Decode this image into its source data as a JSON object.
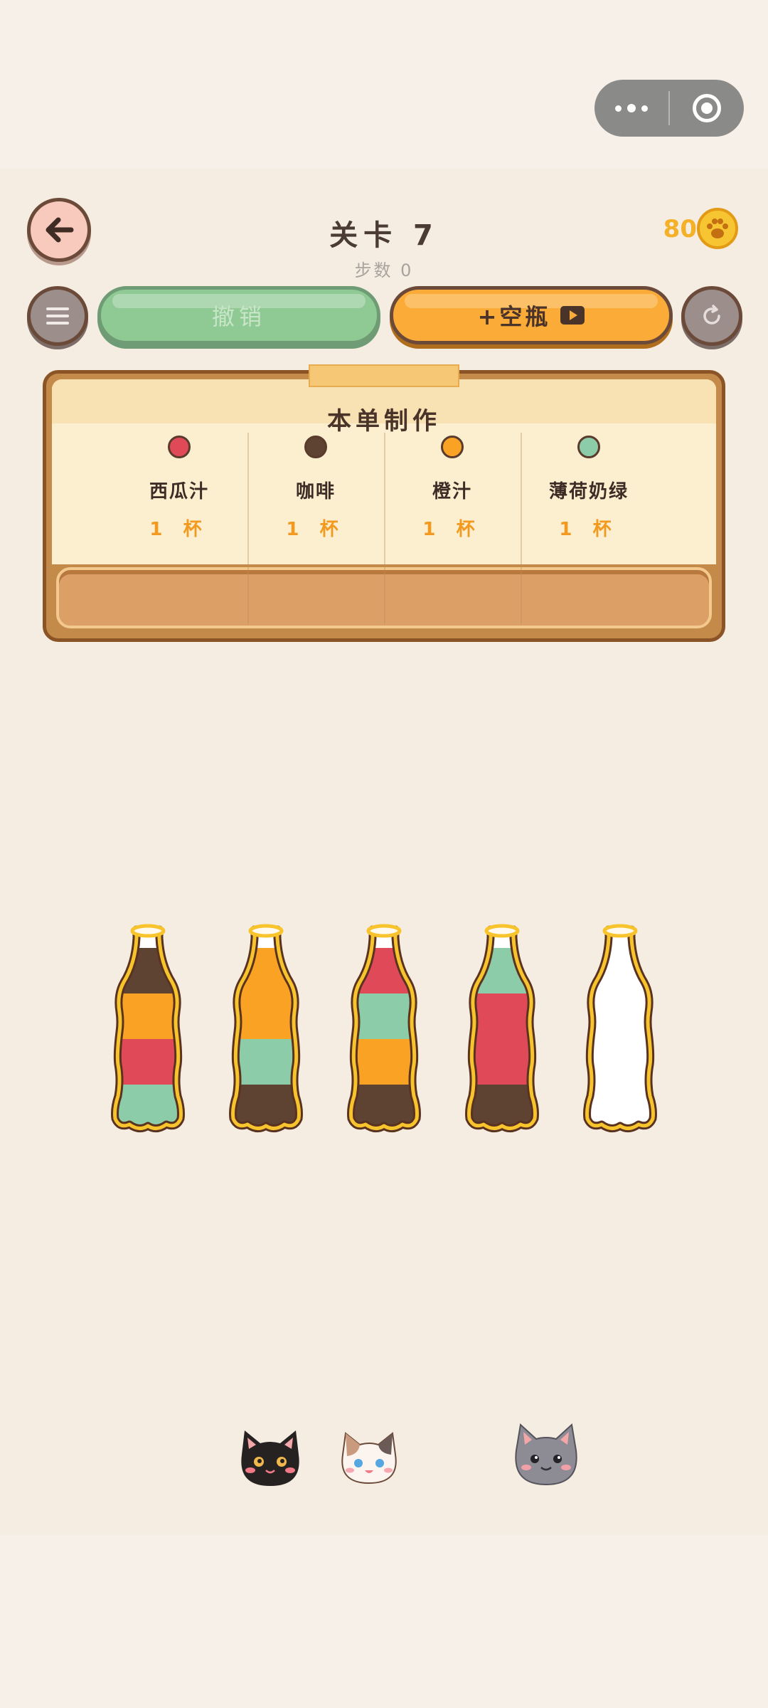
{
  "status": {
    "more_icon": "more-dots-icon",
    "close_icon": "target-circle-icon"
  },
  "header": {
    "level_title": "关卡 7",
    "steps_label": "步数 0",
    "coins": "80",
    "coin_icon": "paw-coin-icon"
  },
  "toolbar": {
    "menu_icon": "menu-icon",
    "undo_label": "撤销",
    "add_bottle_label": "+空瓶",
    "add_bottle_icon": "video-icon",
    "restart_icon": "restart-icon"
  },
  "order": {
    "title": "本单制作",
    "items": [
      {
        "name": "西瓜汁",
        "qty": "1 杯",
        "color": "#e04a58"
      },
      {
        "name": "咖啡",
        "qty": "1 杯",
        "color": "#5e4232"
      },
      {
        "name": "橙汁",
        "qty": "1 杯",
        "color": "#f9a224"
      },
      {
        "name": "薄荷奶绿",
        "qty": "1 杯",
        "color": "#8ccca8"
      }
    ]
  },
  "bottles": [
    {
      "layers_top_to_bottom": [
        "coffee",
        "orange",
        "watermelon",
        "mint"
      ]
    },
    {
      "layers_top_to_bottom": [
        "orange",
        "orange",
        "mint",
        "coffee"
      ]
    },
    {
      "layers_top_to_bottom": [
        "watermelon",
        "mint",
        "orange",
        "coffee"
      ]
    },
    {
      "layers_top_to_bottom": [
        "mint",
        "watermelon",
        "watermelon",
        "coffee"
      ]
    },
    {
      "layers_top_to_bottom": []
    }
  ],
  "colors": {
    "coffee": "#5e4232",
    "orange": "#f9a224",
    "watermelon": "#e04a58",
    "mint": "#8ccca8",
    "bottle_rim": "#f7c42d",
    "bottle_outline": "#5a3320"
  },
  "cats": [
    "black-cat",
    "calico-cat",
    "gray-cat"
  ]
}
